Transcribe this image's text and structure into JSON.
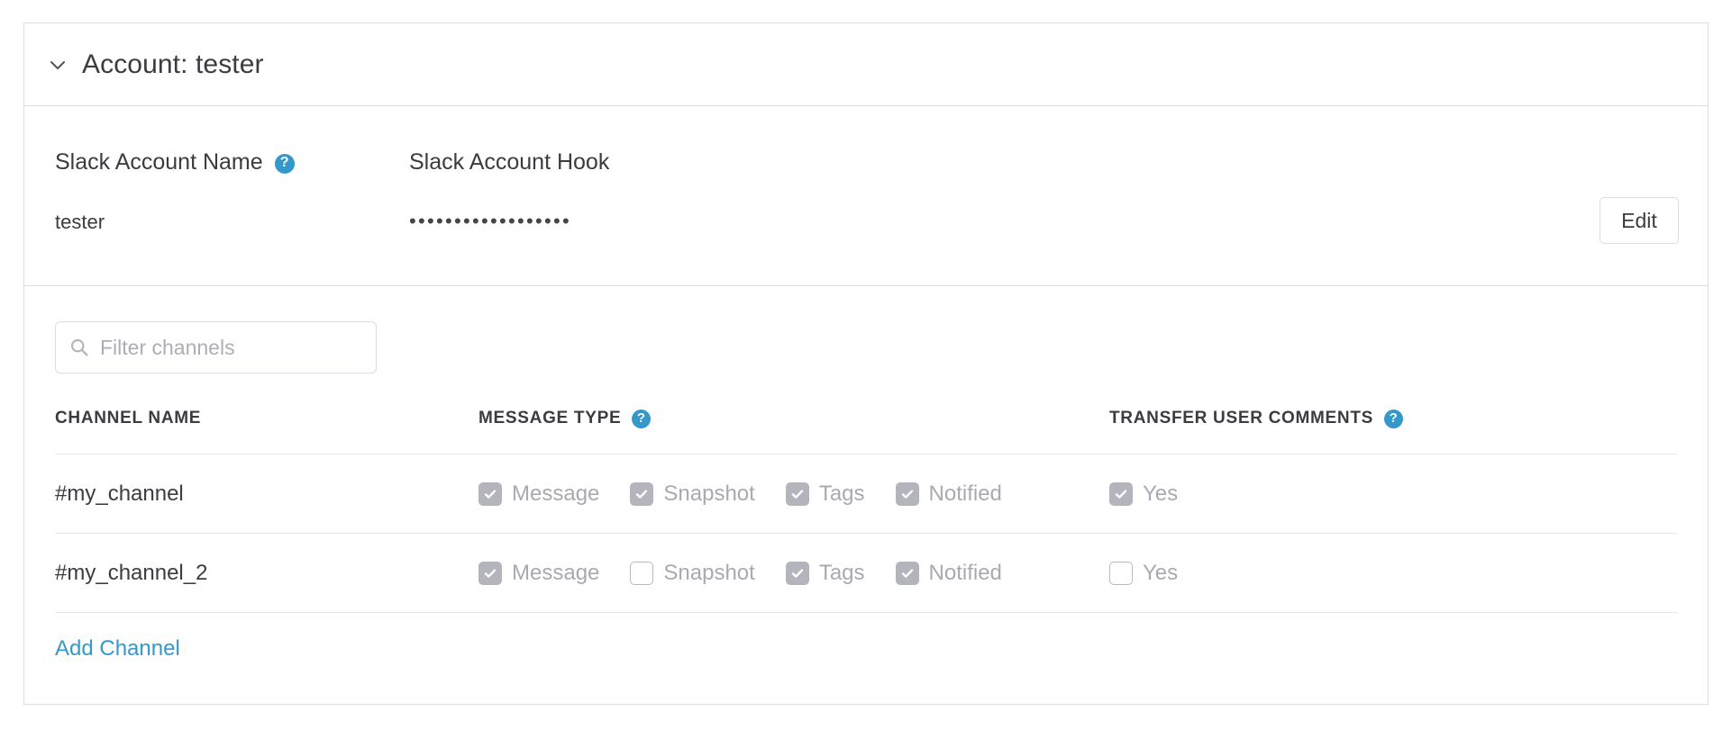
{
  "colors": {
    "accent_blue": "#3498ca",
    "panel_border": "#dddde3",
    "text_dark": "#3b3b42",
    "text_muted": "#a9a9b2",
    "checkbox_checked": "#b4b4bd"
  },
  "account_panel": {
    "header": {
      "title": "Account: tester",
      "collapse_icon": "chevron-down-icon",
      "expanded": true
    },
    "fields": {
      "name_label": "Slack Account Name",
      "name_help_icon": "question-mark-circle-icon",
      "hook_label": "Slack Account Hook",
      "name_value": "tester",
      "hook_value_masked": "••••••••••••••••••",
      "edit_button": "Edit"
    }
  },
  "channels_section": {
    "filter": {
      "placeholder": "Filter channels",
      "value": "",
      "icon": "search-icon"
    },
    "table": {
      "columns": [
        {
          "label": "CHANNEL NAME",
          "help": false
        },
        {
          "label": "MESSAGE TYPE",
          "help": true
        },
        {
          "label": "TRANSFER USER COMMENTS",
          "help": true
        }
      ],
      "rows": [
        {
          "name": "#my_channel",
          "message_type": [
            {
              "label": "Message",
              "checked": true
            },
            {
              "label": "Snapshot",
              "checked": true
            },
            {
              "label": "Tags",
              "checked": true
            },
            {
              "label": "Notified",
              "checked": true
            }
          ],
          "transfer_user_comments": [
            {
              "label": "Yes",
              "checked": true
            }
          ]
        },
        {
          "name": "#my_channel_2",
          "message_type": [
            {
              "label": "Message",
              "checked": true
            },
            {
              "label": "Snapshot",
              "checked": false
            },
            {
              "label": "Tags",
              "checked": true
            },
            {
              "label": "Notified",
              "checked": true
            }
          ],
          "transfer_user_comments": [
            {
              "label": "Yes",
              "checked": false
            }
          ]
        }
      ]
    },
    "add_channel_link": "Add Channel"
  }
}
